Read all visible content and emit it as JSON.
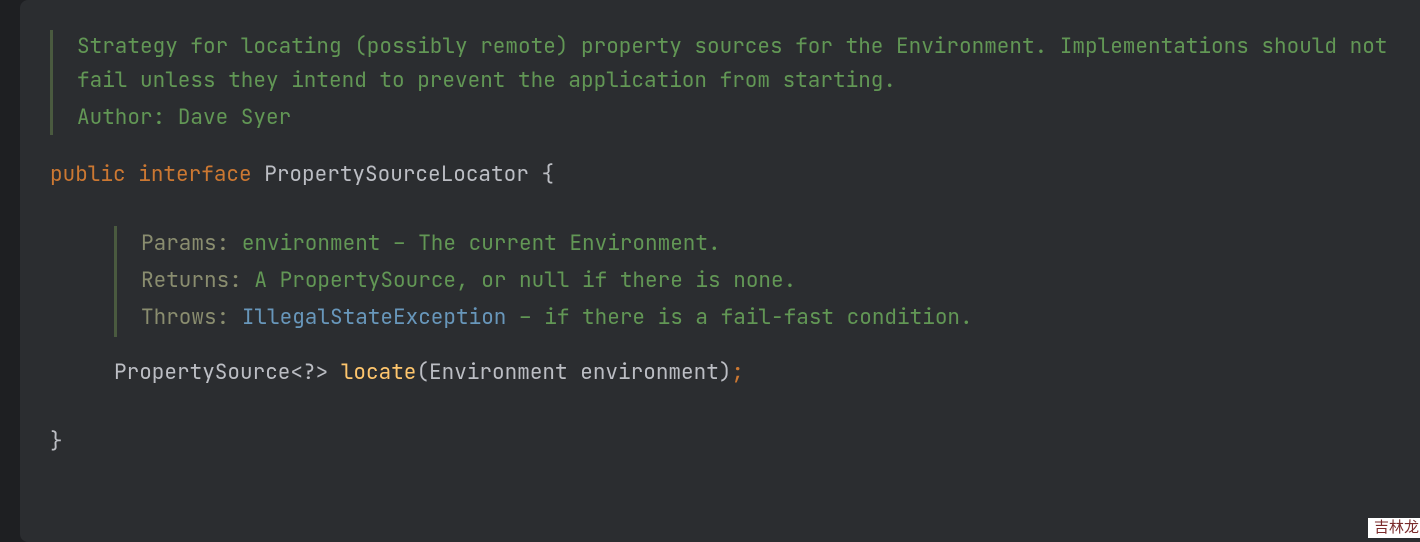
{
  "class_doc": {
    "description": "Strategy for locating (possibly remote) property sources for the Environment. Implementations should not fail unless they intend to prevent the application from starting.",
    "author_label": "Author:",
    "author_value": "Dave Syer"
  },
  "code": {
    "public_kw": "public",
    "interface_kw": "interface",
    "class_name": "PropertySourceLocator",
    "open_brace": "{",
    "close_brace": "}"
  },
  "method_doc": {
    "params_label": "Params:",
    "params_value": "environment – The current Environment.",
    "returns_label": "Returns:",
    "returns_value": "A PropertySource, or null if there is none.",
    "throws_label": "Throws:",
    "throws_type": "IllegalStateException",
    "throws_rest": " – if there is a fail-fast condition."
  },
  "method": {
    "return_type": "PropertySource<?>",
    "name": "locate",
    "params": "(Environment environment)",
    "semicolon": ";"
  },
  "watermark": "吉林龙网"
}
